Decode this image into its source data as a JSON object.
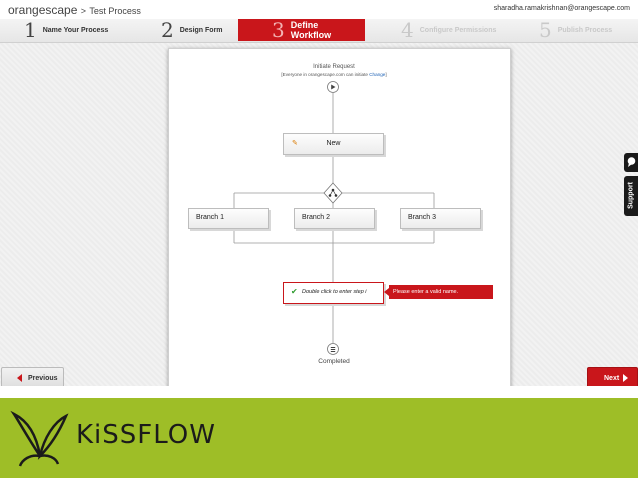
{
  "header": {
    "brand": "orangescape",
    "breadcrumb_sep": ">",
    "process_name": "Test Process",
    "user_email": "sharadha.ramakrishnan@orangescape.com"
  },
  "steps": [
    {
      "num": "1",
      "label": "Name Your Process",
      "state": "done"
    },
    {
      "num": "2",
      "label": "Design Form",
      "state": "done"
    },
    {
      "num": "3",
      "label": "Define Workflow",
      "state": "active"
    },
    {
      "num": "4",
      "label": "Configure Permissions",
      "state": "disabled"
    },
    {
      "num": "5",
      "label": "Publish Process",
      "state": "disabled"
    }
  ],
  "workflow": {
    "initiate_title": "Initiate Request",
    "initiate_sub": "[Everyone in orangescape.com can initiate",
    "initiate_change": "Change",
    "initiate_close": "]",
    "task_label": "New",
    "branches": [
      "Branch 1",
      "Branch 2",
      "Branch 3"
    ],
    "pending_step_label": "Double click to enter step i",
    "error_message": "Please enter a valid name.",
    "completed_label": "Completed"
  },
  "nav": {
    "previous_label": "Previous",
    "next_label": "Next",
    "support_label": "Support"
  },
  "footer": {
    "logo_text": "KiSSFLOW"
  },
  "colors": {
    "accent": "#c9161b",
    "footer_green": "#9ebe27",
    "link": "#1a5fb4"
  }
}
